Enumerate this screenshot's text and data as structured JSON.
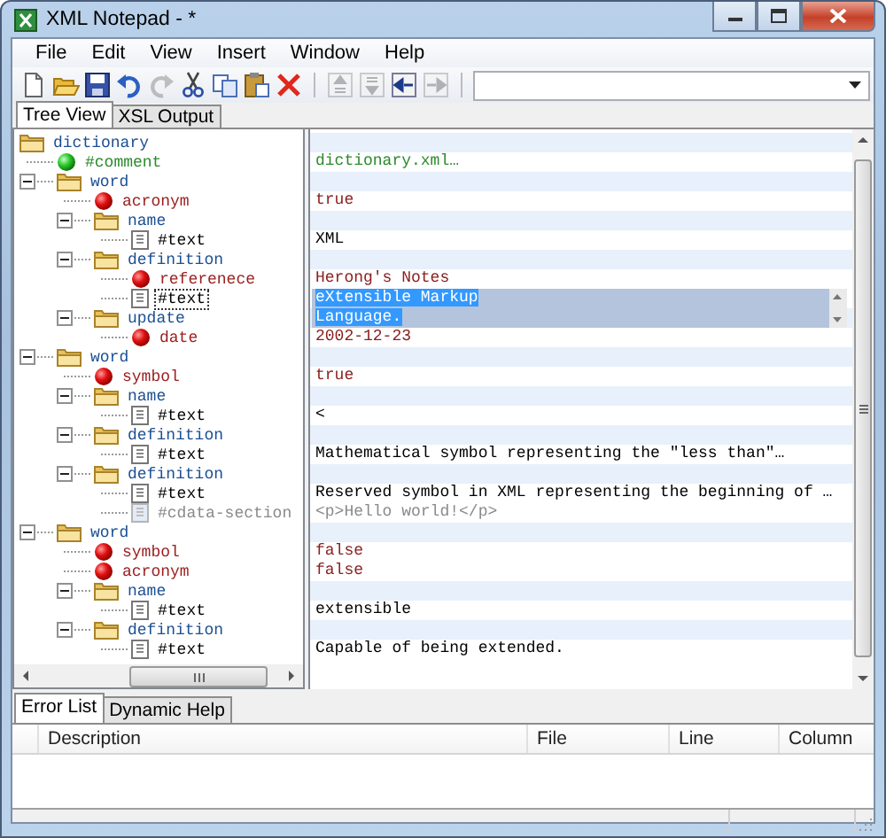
{
  "window": {
    "title": "XML Notepad - *"
  },
  "menu": [
    "File",
    "Edit",
    "View",
    "Insert",
    "Window",
    "Help"
  ],
  "toolbar": [
    [
      {
        "kind": "new",
        "disabled": false
      },
      {
        "kind": "open",
        "disabled": false
      },
      {
        "kind": "save",
        "disabled": false
      },
      {
        "kind": "undo",
        "disabled": false
      },
      {
        "kind": "redo",
        "disabled": true
      },
      {
        "kind": "cut",
        "disabled": false
      },
      {
        "kind": "copy",
        "disabled": false
      },
      {
        "kind": "paste",
        "disabled": false
      },
      {
        "kind": "delete",
        "disabled": false
      }
    ],
    [
      {
        "kind": "nudge-up",
        "disabled": true
      },
      {
        "kind": "nudge-down",
        "disabled": true
      },
      {
        "kind": "nudge-left",
        "disabled": false
      },
      {
        "kind": "nudge-right",
        "disabled": true
      }
    ]
  ],
  "tabs": [
    {
      "label": "Tree View",
      "selected": true
    },
    {
      "label": "XSL Output",
      "selected": false
    }
  ],
  "tree": [
    {
      "name": "dictionary",
      "kind": "element",
      "selected": false,
      "children": [
        {
          "name": "#comment",
          "kind": "comment",
          "selected": false,
          "value": "dictionary.xml…"
        },
        {
          "name": "word",
          "kind": "element",
          "expanded": true,
          "selected": false,
          "children": [
            {
              "name": "acronym",
              "kind": "leaf",
              "selected": false,
              "value": "true"
            },
            {
              "name": "name",
              "kind": "element",
              "expanded": true,
              "selected": false,
              "children": [
                {
                  "name": "#text",
                  "kind": "text",
                  "selected": false,
                  "value": "XML"
                }
              ]
            },
            {
              "name": "definition",
              "kind": "element",
              "expanded": true,
              "selected": false,
              "children": [
                {
                  "name": "referenece",
                  "kind": "leaf",
                  "selected": false,
                  "value": "Herong's Notes"
                },
                {
                  "name": "#text",
                  "kind": "text",
                  "selected": true,
                  "value": "eXtensible Markup\nLanguage."
                }
              ]
            },
            {
              "name": "update",
              "kind": "element",
              "expanded": true,
              "selected": false,
              "children": [
                {
                  "name": "date",
                  "kind": "leaf",
                  "selected": false,
                  "value": "2002-12-23"
                }
              ]
            }
          ]
        },
        {
          "name": "word",
          "kind": "element",
          "expanded": true,
          "selected": false,
          "children": [
            {
              "name": "symbol",
              "kind": "leaf",
              "selected": false,
              "value": "true"
            },
            {
              "name": "name",
              "kind": "element",
              "expanded": true,
              "selected": false,
              "children": [
                {
                  "name": "#text",
                  "kind": "text",
                  "selected": false,
                  "value": "<"
                }
              ]
            },
            {
              "name": "definition",
              "kind": "element",
              "expanded": true,
              "selected": false,
              "children": [
                {
                  "name": "#text",
                  "kind": "text",
                  "selected": false,
                  "value": "Mathematical symbol representing the \"less than\"…"
                }
              ]
            },
            {
              "name": "definition",
              "kind": "element",
              "expanded": true,
              "selected": false,
              "children": [
                {
                  "name": "#text",
                  "kind": "text",
                  "selected": false,
                  "value": "Reserved symbol in XML representing the beginning of …"
                },
                {
                  "name": "#cdata-section",
                  "kind": "cdata",
                  "selected": false,
                  "value": "<p>Hello world!</p>"
                }
              ]
            }
          ]
        },
        {
          "name": "word",
          "kind": "element",
          "expanded": true,
          "selected": false,
          "children": [
            {
              "name": "symbol",
              "kind": "leaf",
              "selected": false,
              "value": "false"
            },
            {
              "name": "acronym",
              "kind": "leaf",
              "selected": false,
              "value": "false"
            },
            {
              "name": "name",
              "kind": "element",
              "expanded": true,
              "selected": false,
              "children": [
                {
                  "name": "#text",
                  "kind": "text",
                  "selected": false,
                  "value": "extensible"
                }
              ]
            },
            {
              "name": "definition",
              "kind": "element",
              "expanded": true,
              "selected": false,
              "children": [
                {
                  "name": "#text",
                  "kind": "text",
                  "selected": false,
                  "value": "Capable of being extended."
                }
              ]
            }
          ]
        }
      ]
    }
  ],
  "bottom_tabs": [
    {
      "label": "Error List",
      "selected": true
    },
    {
      "label": "Dynamic Help",
      "selected": false
    }
  ],
  "error_columns": [
    "Description",
    "File",
    "Line",
    "Column"
  ]
}
